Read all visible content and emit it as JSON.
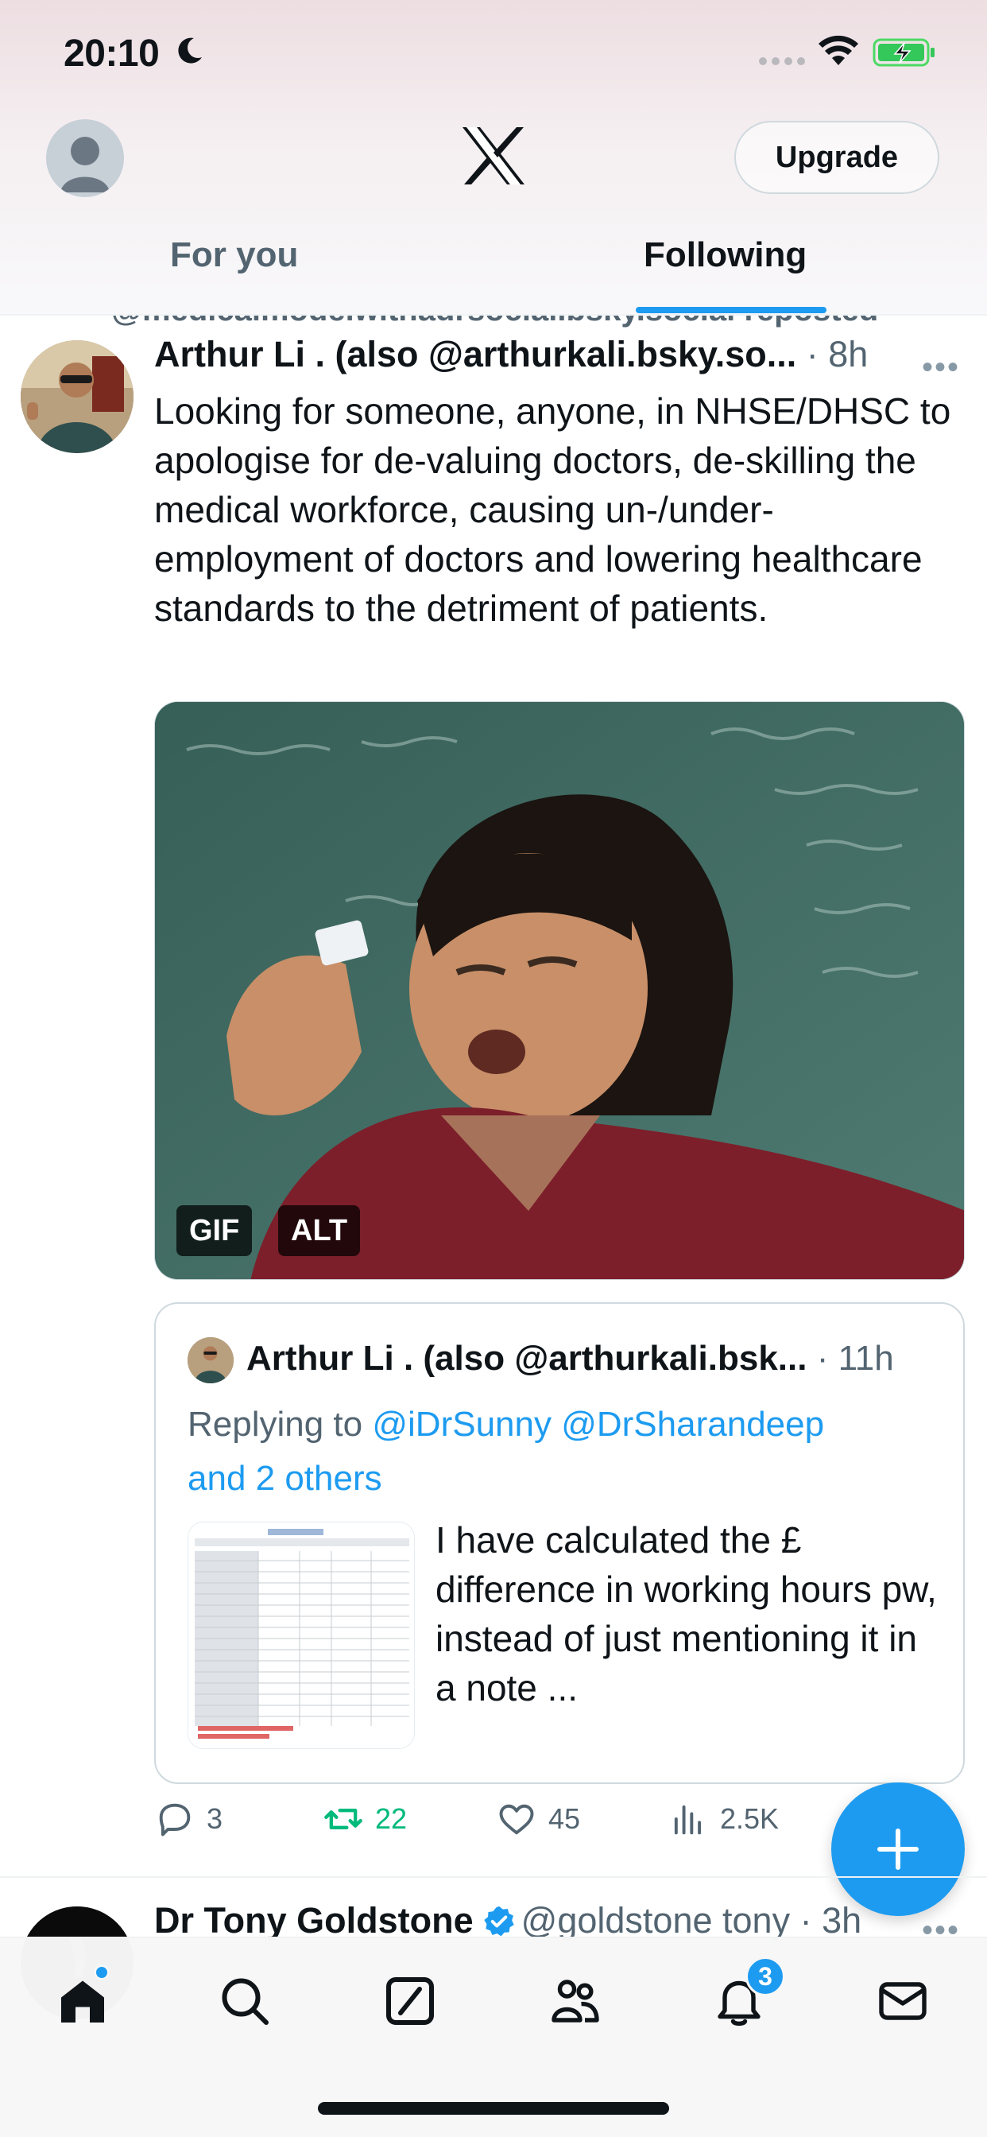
{
  "status_bar": {
    "time": "20:10"
  },
  "header": {
    "upgrade_label": "Upgrade",
    "tabs": [
      {
        "label": "For you",
        "active": false
      },
      {
        "label": "Following",
        "active": true
      }
    ]
  },
  "feed": {
    "reposted_by": "@medicalmodelwithadrsocial.bsky.social reposted",
    "tweet": {
      "author": "Arthur Li . (also @arthurkali.bsky.so...",
      "time": "8h",
      "text": "Looking for someone, anyone, in NHSE/DHSC to apologise for de-valuing doctors, de-skilling the medical workforce, causing un-/under-employment of doctors and lowering healthcare standards to the detriment of patients.",
      "media_badges": {
        "gif": "GIF",
        "alt": "ALT"
      },
      "quote": {
        "author": "Arthur Li . (also @arthurkali.bsk...",
        "time": "11h",
        "replying_prefix": "Replying to ",
        "replying_to": "@iDrSunny @DrSharandeep",
        "and_others": "and 2 others",
        "text": "I have calculated the £ difference in working hours pw, instead of just mentioning it in a note ..."
      },
      "actions": {
        "replies": "3",
        "reposts": "22",
        "likes": "45",
        "views": "2.5K"
      }
    },
    "tweet2": {
      "author": "Dr Tony Goldstone",
      "handle": "@goldstone tony",
      "time": "3h"
    }
  },
  "bottom_nav": {
    "notifications_count": "3"
  },
  "colors": {
    "accent": "#1d9bf0",
    "repost_active": "#00ba7c",
    "text": "#0f1419",
    "secondary": "#536471"
  }
}
